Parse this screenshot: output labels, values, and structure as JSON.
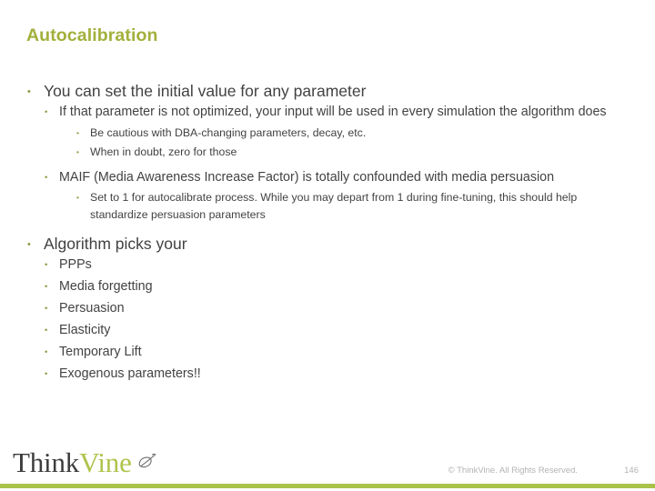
{
  "slide": {
    "title": "Autocalibration",
    "title_color": "#a3b03c",
    "bullet_color": "#8f9b43",
    "body_color": "#424242",
    "accent_bar_color": "#a9c24a",
    "bullet_glyph": "•",
    "content": [
      {
        "level": 1,
        "text": "You can set the initial value for any parameter"
      },
      {
        "level": 2,
        "text": "If that parameter is not optimized, your input will be used in every simulation the algorithm does"
      },
      {
        "level": 3,
        "text": "Be cautious with DBA-changing parameters, decay, etc."
      },
      {
        "level": 3,
        "text": "When in doubt, zero for those"
      },
      {
        "level": 2,
        "text": "MAIF (Media Awareness Increase Factor) is totally confounded with media persuasion"
      },
      {
        "level": 3,
        "text": "Set to 1 for autocalibrate process.  While you may depart from 1 during fine-tuning, this should help standardize persuasion parameters"
      },
      {
        "level": 1,
        "text": "Algorithm picks your"
      },
      {
        "level": 2,
        "text": "PPPs"
      },
      {
        "level": 2,
        "text": "Media forgetting"
      },
      {
        "level": 2,
        "text": "Persuasion"
      },
      {
        "level": 2,
        "text": "Elasticity"
      },
      {
        "level": 2,
        "text": "Temporary Lift"
      },
      {
        "level": 2,
        "text": "Exogenous parameters!!"
      }
    ]
  },
  "footer": {
    "logo_first": "Think",
    "logo_second": "Vine",
    "logo_leaf_icon": "leaf-icon",
    "copyright": "© ThinkVine.  All Rights Reserved.",
    "page_number": "146"
  }
}
